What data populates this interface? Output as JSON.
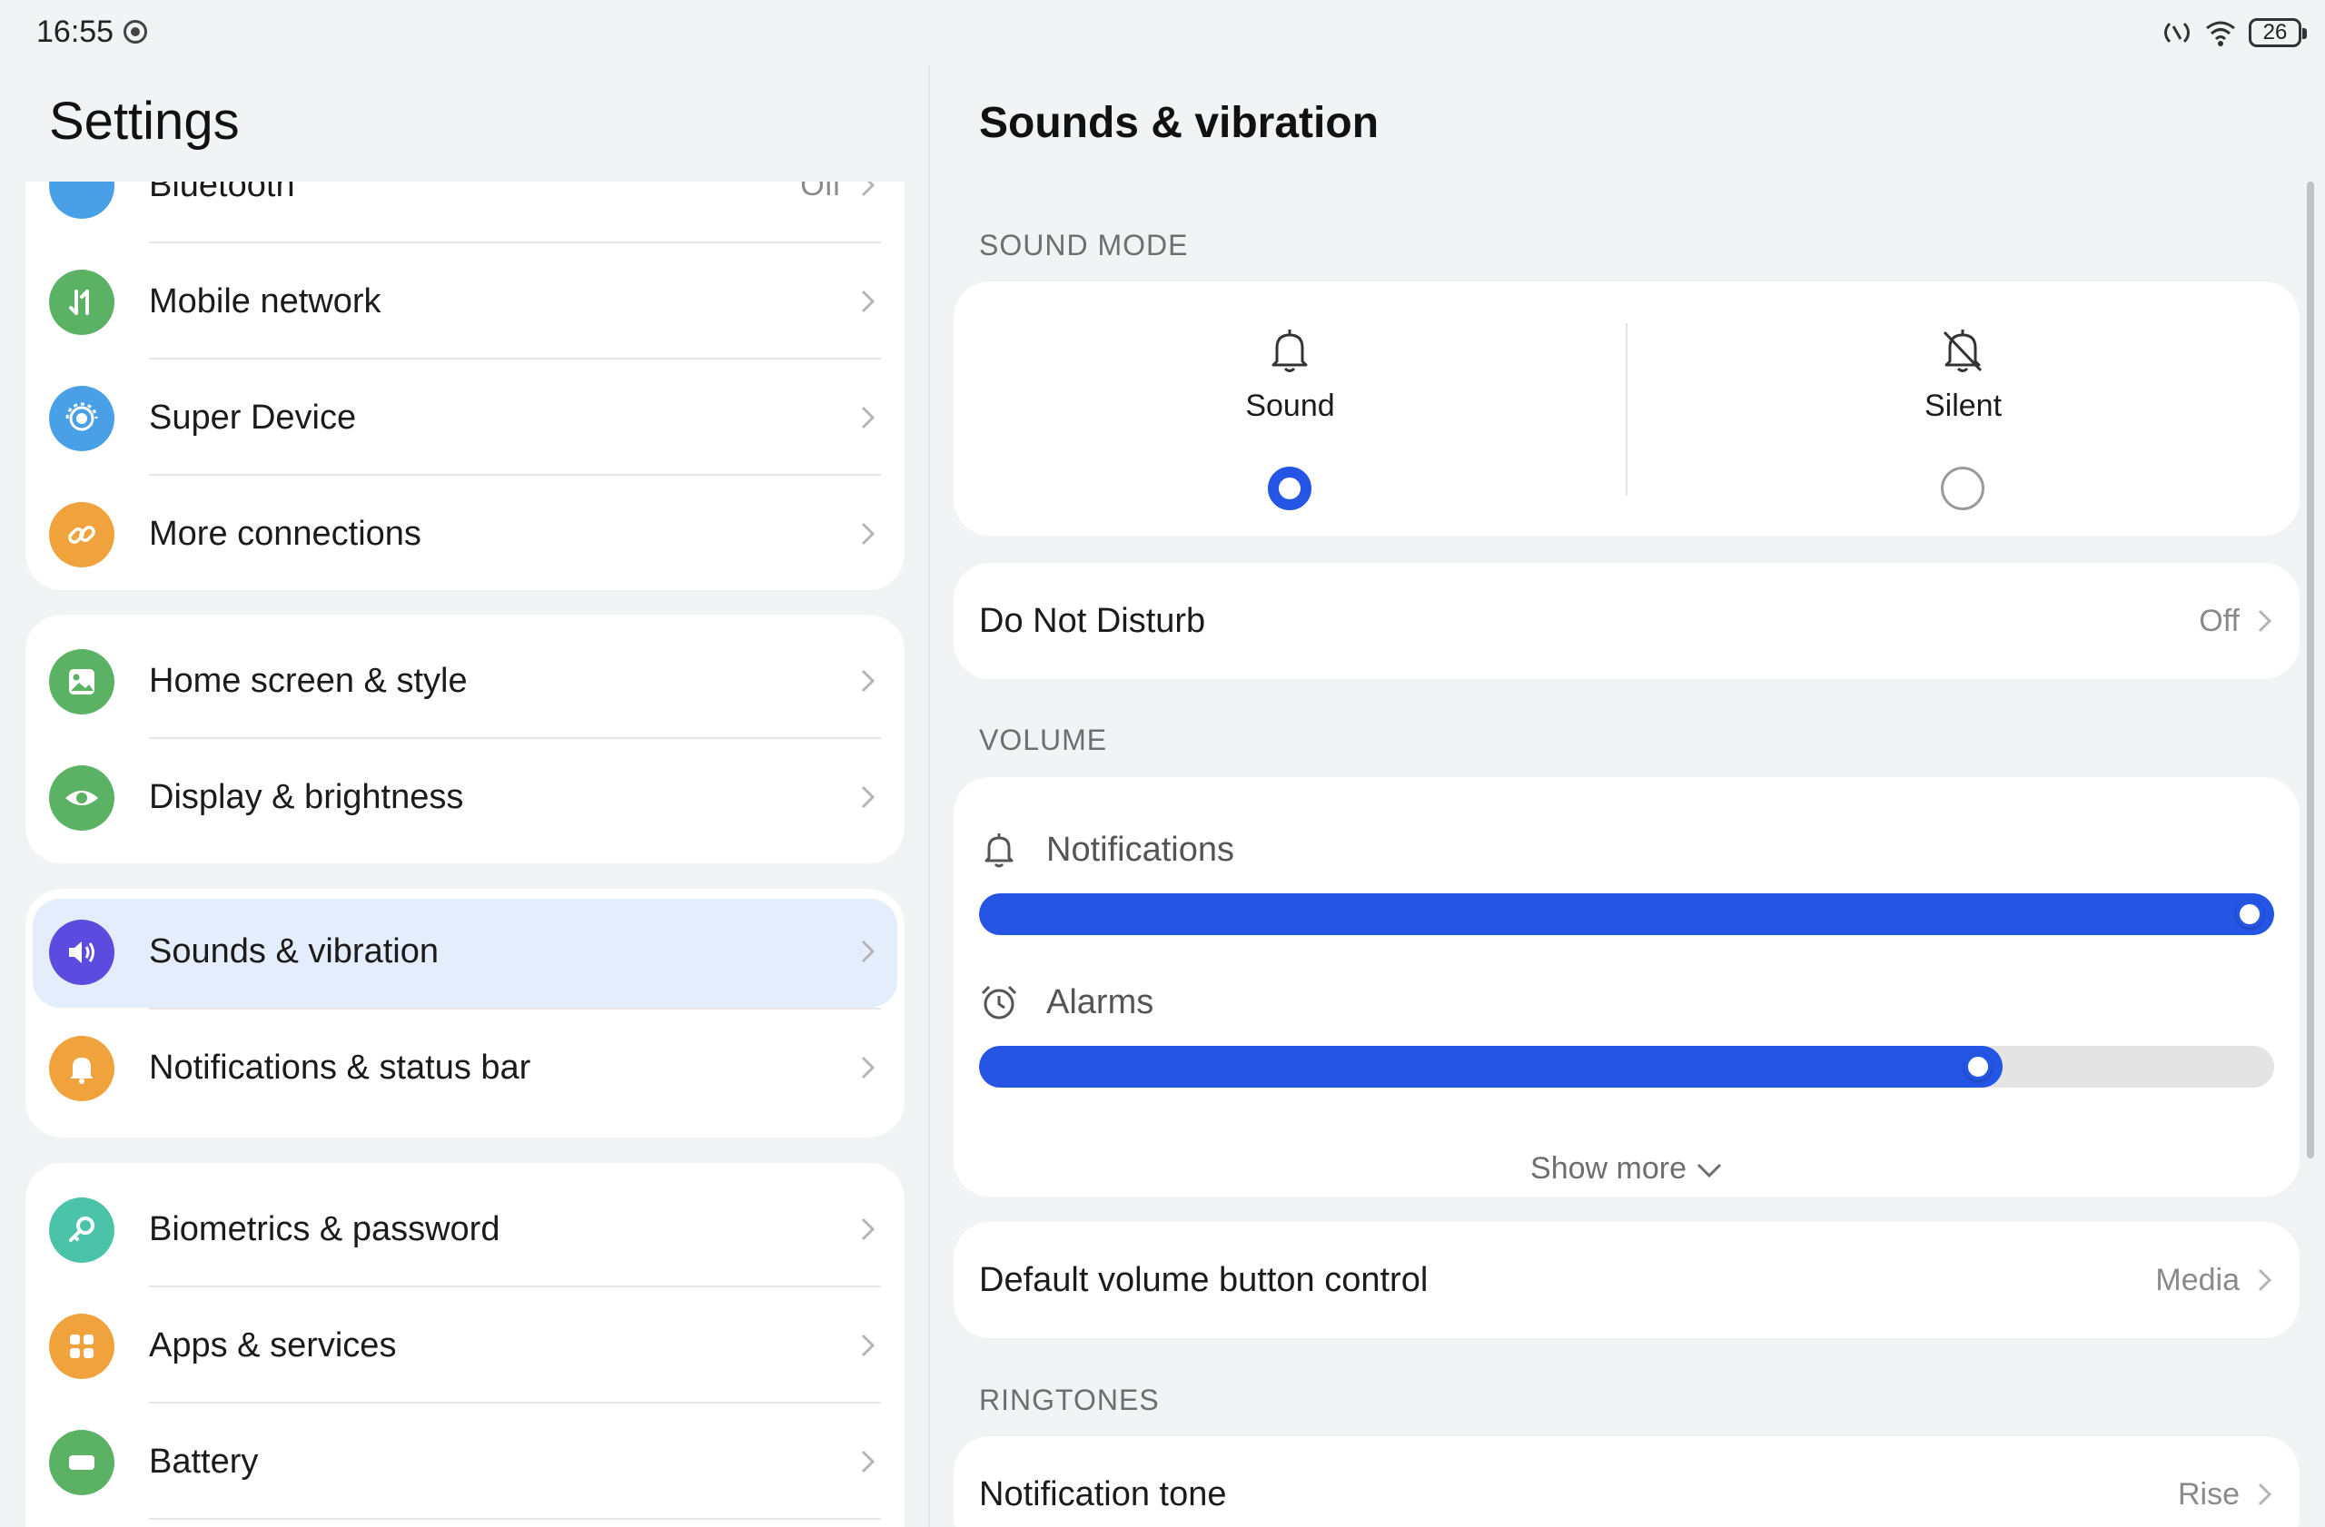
{
  "status_bar": {
    "time": "16:55",
    "battery": "26"
  },
  "left": {
    "title": "Settings",
    "partial_item": {
      "label": "Bluetooth",
      "value": "Off"
    },
    "groups": [
      {
        "items": [
          {
            "label": "Mobile network",
            "icon": "mobile-network-icon",
            "color": "#5bb264"
          },
          {
            "label": "Super Device",
            "icon": "super-device-icon",
            "color": "#4aa0e6"
          },
          {
            "label": "More connections",
            "icon": "link-icon",
            "color": "#f0a23c"
          }
        ]
      },
      {
        "items": [
          {
            "label": "Home screen & style",
            "icon": "image-icon",
            "color": "#5bb264"
          },
          {
            "label": "Display & brightness",
            "icon": "eye-icon",
            "color": "#5bb264"
          }
        ]
      },
      {
        "items": [
          {
            "label": "Sounds & vibration",
            "icon": "speaker-icon",
            "color": "#5b4bdf",
            "selected": true
          },
          {
            "label": "Notifications & status bar",
            "icon": "bell-icon",
            "color": "#f0a23c"
          }
        ]
      },
      {
        "items": [
          {
            "label": "Biometrics & password",
            "icon": "key-icon",
            "color": "#4bc3a8"
          },
          {
            "label": "Apps & services",
            "icon": "apps-icon",
            "color": "#f0a23c"
          },
          {
            "label": "Battery",
            "icon": "battery-icon",
            "color": "#5bb264"
          }
        ]
      }
    ]
  },
  "right": {
    "title": "Sounds & vibration",
    "sound_mode": {
      "section": "SOUND MODE",
      "options": [
        {
          "label": "Sound",
          "selected": true
        },
        {
          "label": "Silent",
          "selected": false
        }
      ]
    },
    "dnd": {
      "label": "Do Not Disturb",
      "value": "Off"
    },
    "volume": {
      "section": "VOLUME",
      "items": [
        {
          "label": "Notifications",
          "level": 1.0
        },
        {
          "label": "Alarms",
          "level": 0.79
        }
      ],
      "show_more": "Show more"
    },
    "default_volume": {
      "label": "Default volume button control",
      "value": "Media"
    },
    "ringtones": {
      "section": "RINGTONES",
      "items": [
        {
          "label": "Notification tone",
          "value": "Rise"
        }
      ]
    },
    "accent_color": "#2455e4"
  }
}
